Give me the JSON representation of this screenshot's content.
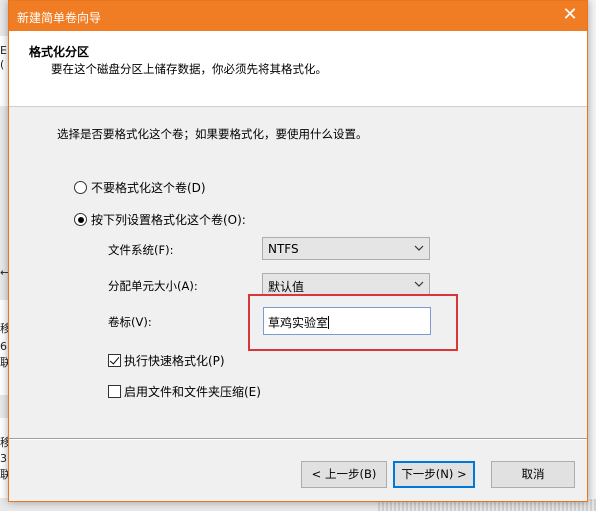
{
  "background": {
    "left_chars": [
      "E",
      "(",
      "←",
      "移",
      "6",
      "联",
      "移",
      "3",
      "联"
    ]
  },
  "dialog": {
    "title": "新建简单卷向导",
    "close_glyph": "✕",
    "header": {
      "title": "格式化分区",
      "subtitle": "要在这个磁盘分区上储存数据，你必须先将其格式化。"
    },
    "prompt": "选择是否要格式化这个卷；如果要格式化，要使用什么设置。",
    "options": {
      "no_format": "不要格式化这个卷(D)",
      "format_with": "按下列设置格式化这个卷(O):"
    },
    "fields": {
      "filesystem_label": "文件系统(F):",
      "filesystem_value": "NTFS",
      "alloc_label": "分配单元大小(A):",
      "alloc_value": "默认值",
      "volume_label": "卷标(V):",
      "volume_value": "草鸡实验室"
    },
    "checkboxes": {
      "quick_format": "执行快速格式化(P)",
      "compression": "启用文件和文件夹压缩(E)"
    },
    "buttons": {
      "back": "< 上一步(B)",
      "next": "下一步(N) >",
      "cancel": "取消"
    },
    "colors": {
      "titlebar": "#f07c24",
      "highlight": "#d9363a",
      "focus": "#0078d7"
    }
  }
}
